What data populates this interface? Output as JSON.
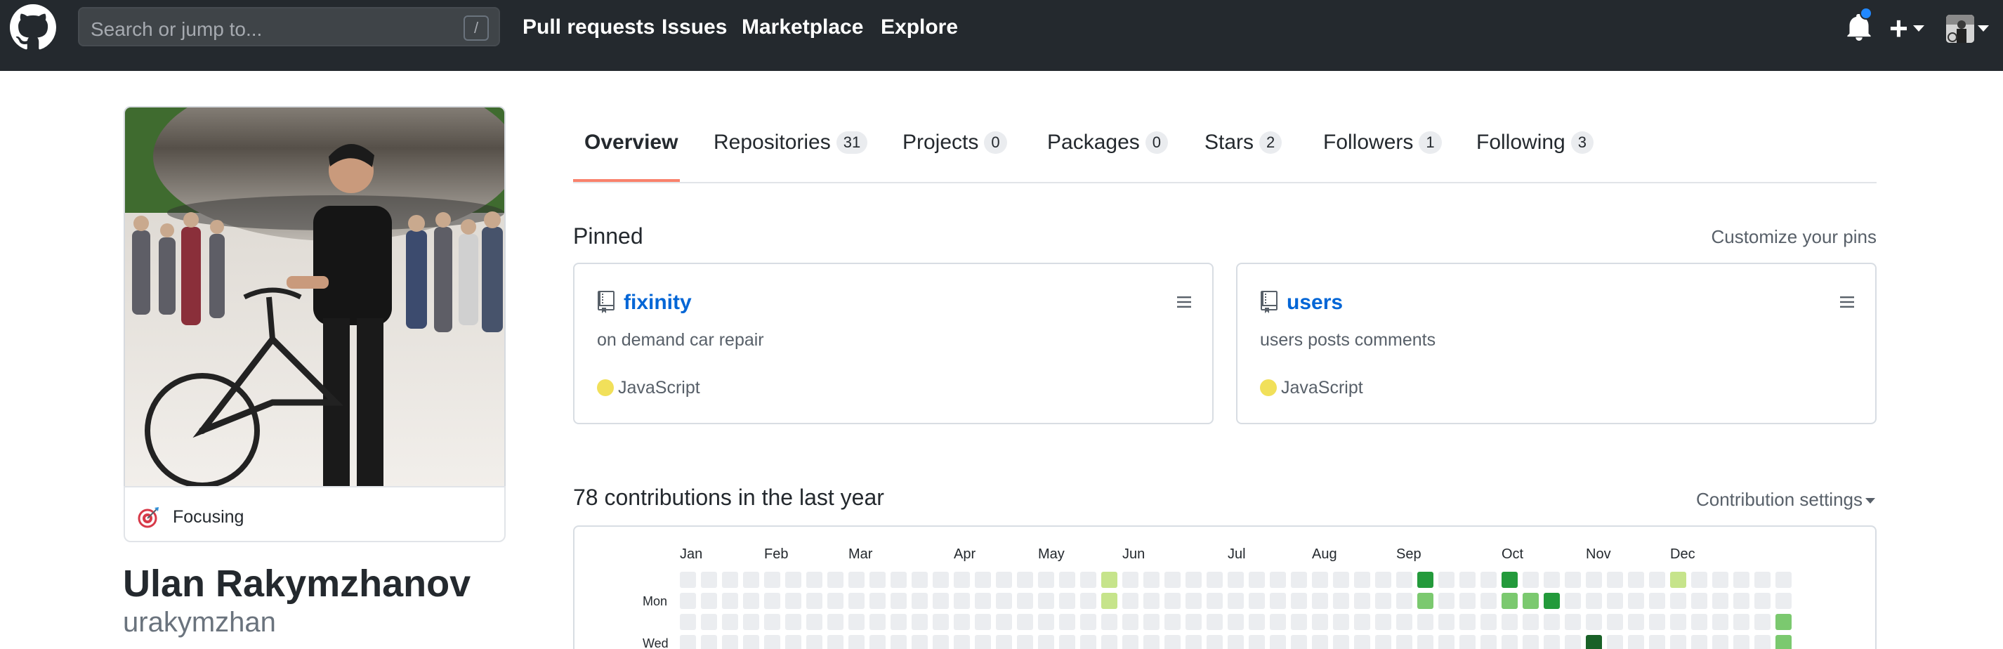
{
  "header": {
    "search_placeholder": "Search or jump to...",
    "search_shortcut": "/",
    "nav": [
      "Pull requests",
      "Issues",
      "Marketplace",
      "Explore"
    ],
    "icons": [
      "github-logo-icon",
      "bell-icon",
      "plus-icon",
      "avatar"
    ]
  },
  "profile": {
    "status": "Focusing",
    "name": "Ulan Rakymzhanov",
    "username": "urakymzhan"
  },
  "tabs": [
    {
      "label": "Overview",
      "count": null,
      "selected": true
    },
    {
      "label": "Repositories",
      "count": "31"
    },
    {
      "label": "Projects",
      "count": "0"
    },
    {
      "label": "Packages",
      "count": "0"
    },
    {
      "label": "Stars",
      "count": "2"
    },
    {
      "label": "Followers",
      "count": "1"
    },
    {
      "label": "Following",
      "count": "3"
    }
  ],
  "pinned": {
    "title": "Pinned",
    "customize": "Customize your pins",
    "repos": [
      {
        "name": "fixinity",
        "description": "on demand car repair",
        "language": "JavaScript",
        "language_color": "#f1e05a"
      },
      {
        "name": "users",
        "description": "users posts comments",
        "language": "JavaScript",
        "language_color": "#f1e05a"
      }
    ]
  },
  "contributions": {
    "title": "78 contributions in the last year",
    "settings": "Contribution settings",
    "months": [
      "Jan",
      "Feb",
      "Mar",
      "Apr",
      "May",
      "Jun",
      "Jul",
      "Aug",
      "Sep",
      "Oct",
      "Nov",
      "Dec"
    ],
    "days": [
      "Mon",
      "Wed"
    ],
    "level_colors": [
      "#ebedf0",
      "#c6e48b",
      "#7bc96f",
      "#239a3b",
      "#196127"
    ],
    "week_count": 53,
    "active_days": [
      {
        "week": 20,
        "day": 0,
        "level": 1
      },
      {
        "week": 20,
        "day": 1,
        "level": 1
      },
      {
        "week": 35,
        "day": 0,
        "level": 3
      },
      {
        "week": 35,
        "day": 1,
        "level": 2
      },
      {
        "week": 39,
        "day": 0,
        "level": 3
      },
      {
        "week": 39,
        "day": 1,
        "level": 2
      },
      {
        "week": 40,
        "day": 1,
        "level": 2
      },
      {
        "week": 41,
        "day": 1,
        "level": 3
      },
      {
        "week": 43,
        "day": 3,
        "level": 4
      },
      {
        "week": 47,
        "day": 0,
        "level": 1
      },
      {
        "week": 52,
        "day": 2,
        "level": 2
      },
      {
        "week": 52,
        "day": 3,
        "level": 2
      }
    ]
  }
}
